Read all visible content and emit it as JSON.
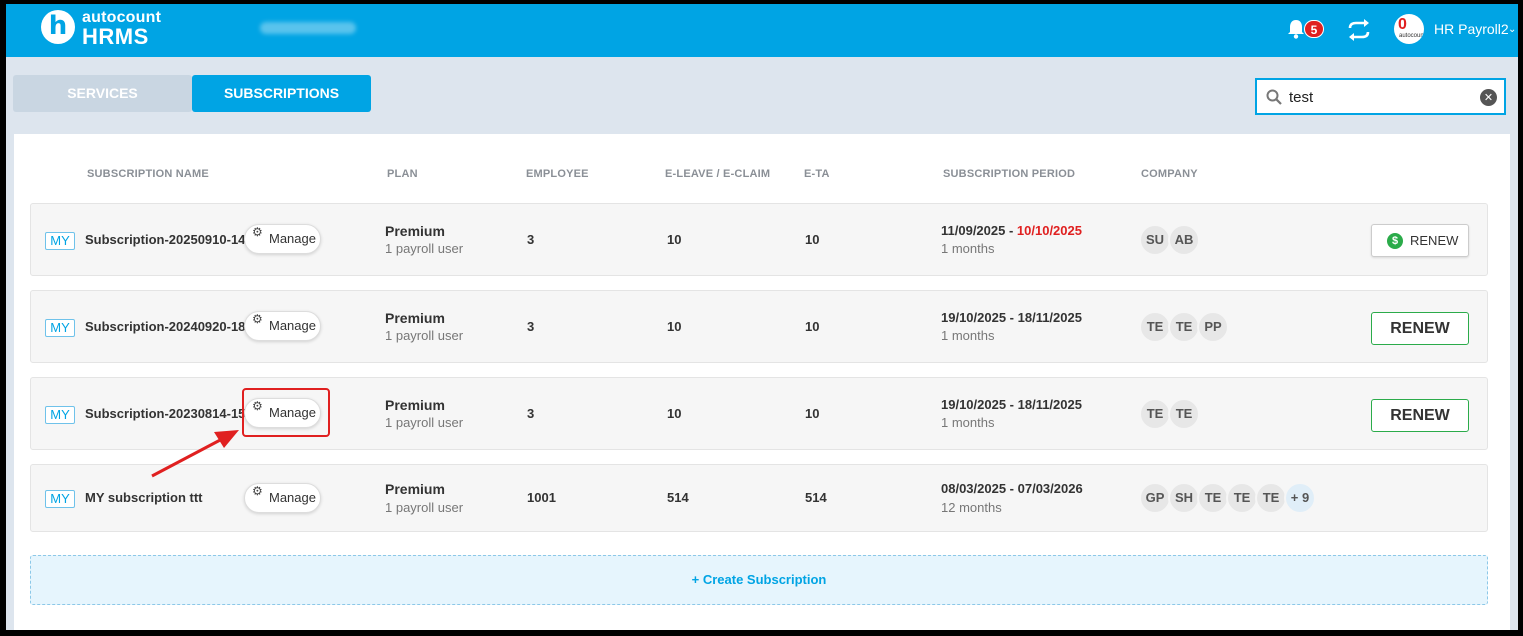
{
  "brand": {
    "top": "autocount",
    "bottom": "HRMS"
  },
  "header": {
    "notifications_count": "5",
    "user_name": "HR Payroll2",
    "avatar_top": "0",
    "avatar_bottom": "autocount"
  },
  "tabs": {
    "services": "SERVICES",
    "subscriptions": "SUBSCRIPTIONS"
  },
  "search": {
    "value": "test"
  },
  "columns": {
    "name": "SUBSCRIPTION NAME",
    "plan": "PLAN",
    "employee": "EMPLOYEE",
    "eleave": "E-LEAVE / E-CLAIM",
    "eta": "E-TA",
    "period": "SUBSCRIPTION PERIOD",
    "company": "COMPANY"
  },
  "rows": [
    {
      "region": "MY",
      "name": "Subscription-20250910-14",
      "manage": "Manage",
      "plan": "Premium",
      "plan_sub": "1 payroll user",
      "employee": "3",
      "eleave": "10",
      "eta": "10",
      "period_start": "11/09/2025 - ",
      "period_end": "10/10/2025",
      "period_sub": "1 months",
      "companies": [
        "SU",
        "AB"
      ],
      "renew": "RENEW"
    },
    {
      "region": "MY",
      "name": "Subscription-20240920-18",
      "manage": "Manage",
      "plan": "Premium",
      "plan_sub": "1 payroll user",
      "employee": "3",
      "eleave": "10",
      "eta": "10",
      "period": "19/10/2025 - 18/11/2025",
      "period_sub": "1 months",
      "companies": [
        "TE",
        "TE",
        "PP"
      ],
      "renew": "RENEW"
    },
    {
      "region": "MY",
      "name": "Subscription-20230814-15",
      "manage": "Manage",
      "plan": "Premium",
      "plan_sub": "1 payroll user",
      "employee": "3",
      "eleave": "10",
      "eta": "10",
      "period": "19/10/2025 - 18/11/2025",
      "period_sub": "1 months",
      "companies": [
        "TE",
        "TE"
      ],
      "renew": "RENEW"
    },
    {
      "region": "MY",
      "name": "MY subscription ttt",
      "manage": "Manage",
      "plan": "Premium",
      "plan_sub": "1 payroll user",
      "employee": "1001",
      "eleave": "514",
      "eta": "514",
      "period": "08/03/2025 - 07/03/2026",
      "period_sub": "12 months",
      "companies": [
        "GP",
        "SH",
        "TE",
        "TE",
        "TE"
      ],
      "companies_more": "+ 9"
    }
  ],
  "create": {
    "label": "Create Subscription"
  },
  "colors": {
    "primary": "#00a4e4",
    "danger": "#e02020",
    "success": "#2bab4a"
  }
}
